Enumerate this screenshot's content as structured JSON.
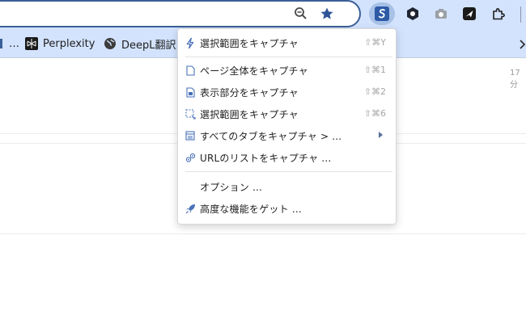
{
  "bookmarks": {
    "items": [
      {
        "label": "…"
      },
      {
        "label": "Perplexity"
      },
      {
        "label": "DeepL翻訳："
      }
    ],
    "more_icon": "chevron-right-icon"
  },
  "page": {
    "timestamp": "17分"
  },
  "menu": {
    "items": [
      {
        "label": "選択範囲をキャプチャ",
        "shortcut": "⇧⌘Y",
        "icon": "lightning-icon"
      },
      {
        "label": "ページ全体をキャプチャ",
        "shortcut": "⇧⌘1",
        "icon": "page-icon"
      },
      {
        "label": "表示部分をキャプチャ",
        "shortcut": "⇧⌘2",
        "icon": "visible-area-icon"
      },
      {
        "label": "選択範囲をキャプチャ",
        "shortcut": "⇧⌘6",
        "icon": "selection-icon"
      },
      {
        "label": "すべてのタブをキャプチャ > ...",
        "shortcut": "",
        "icon": "tabs-icon",
        "submenu": true
      },
      {
        "label": "URLのリストをキャプチャ ...",
        "shortcut": "",
        "icon": "links-icon"
      },
      {
        "label": "オプション ...",
        "shortcut": "",
        "icon": ""
      },
      {
        "label": "高度な機能をゲット ...",
        "shortcut": "",
        "icon": "rocket-icon"
      }
    ]
  },
  "colors": {
    "toolbar_bg": "#d3e3fd",
    "accent": "#3b5f98",
    "menu_icon": "#4a72b8"
  }
}
